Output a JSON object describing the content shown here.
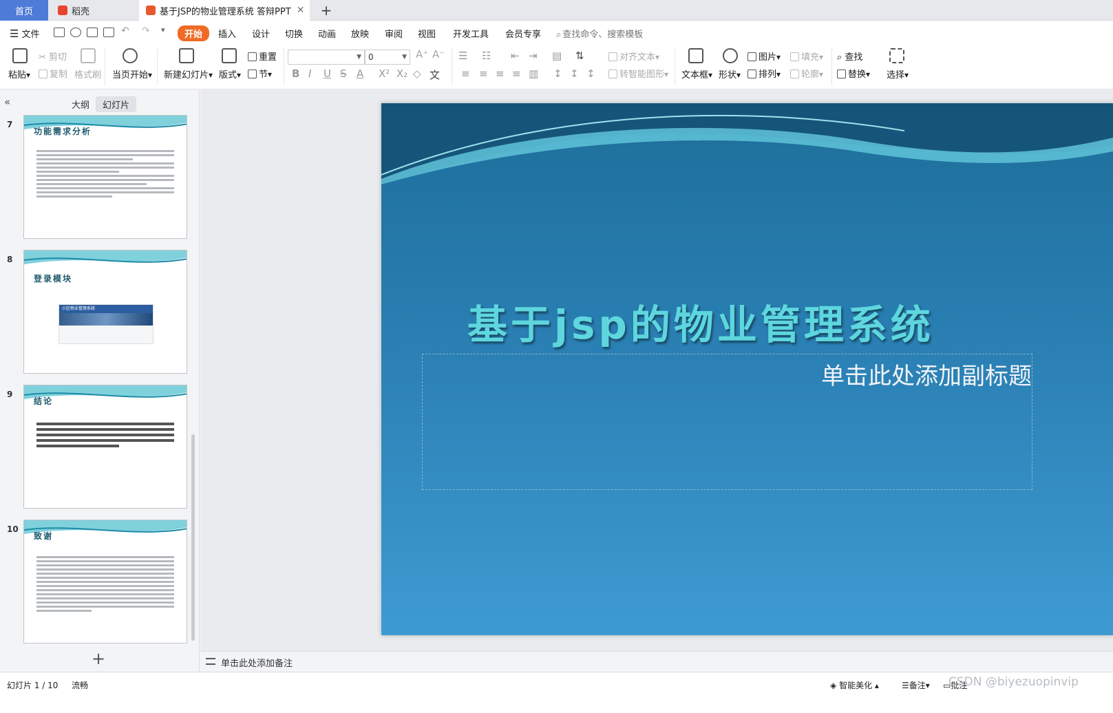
{
  "tabs": {
    "home": "首页",
    "daoke": "稻壳",
    "doc": "基于JSP的物业管理系统 答辩PPT",
    "close_glyph": "✕",
    "new_glyph": "+"
  },
  "menubar": {
    "file": "文件",
    "items": [
      "开始",
      "插入",
      "设计",
      "切换",
      "动画",
      "放映",
      "审阅",
      "视图",
      "开发工具",
      "会员专享"
    ],
    "search": "查找命令、搜索模板"
  },
  "ribbon": {
    "paste": "粘贴",
    "cut": "剪切",
    "copy": "复制",
    "format_painter": "格式刷",
    "from_current": "当页开始",
    "new_slide": "新建幻灯片",
    "layout": "版式",
    "reset": "重置",
    "section": "节",
    "font_size": "0",
    "align_text": "对齐文本",
    "smartart": "转智能图形",
    "textbox": "文本框",
    "shape": "形状",
    "picture": "图片",
    "arrange": "排列",
    "fill": "填充",
    "outline": "轮廓",
    "find": "查找",
    "replace": "替换",
    "select": "选择"
  },
  "left_panel": {
    "outline_tab": "大纲",
    "slides_tab": "幻灯片",
    "add_glyph": "+",
    "slides": [
      {
        "num": "7",
        "title": "功能需求分析"
      },
      {
        "num": "8",
        "title": "登录模块",
        "inner": "小区物业管理系统"
      },
      {
        "num": "9",
        "title": "结论"
      },
      {
        "num": "10",
        "title": "致谢"
      }
    ]
  },
  "slide": {
    "title": "基于jsp的物业管理系统",
    "subtitle": "单击此处添加副标题"
  },
  "notes": {
    "placeholder": "单击此处添加备注"
  },
  "status": {
    "slide_pos": "幻灯片 1 / 10",
    "theme": "流畅",
    "beautify": "智能美化",
    "notes_btn": "备注",
    "comment_btn": "批注",
    "watermark": "CSDN @biyezuopinvip"
  },
  "colors": {
    "accent": "#f06a24",
    "home_tab": "#4f7bd8",
    "slide_title": "#5ed6de"
  }
}
